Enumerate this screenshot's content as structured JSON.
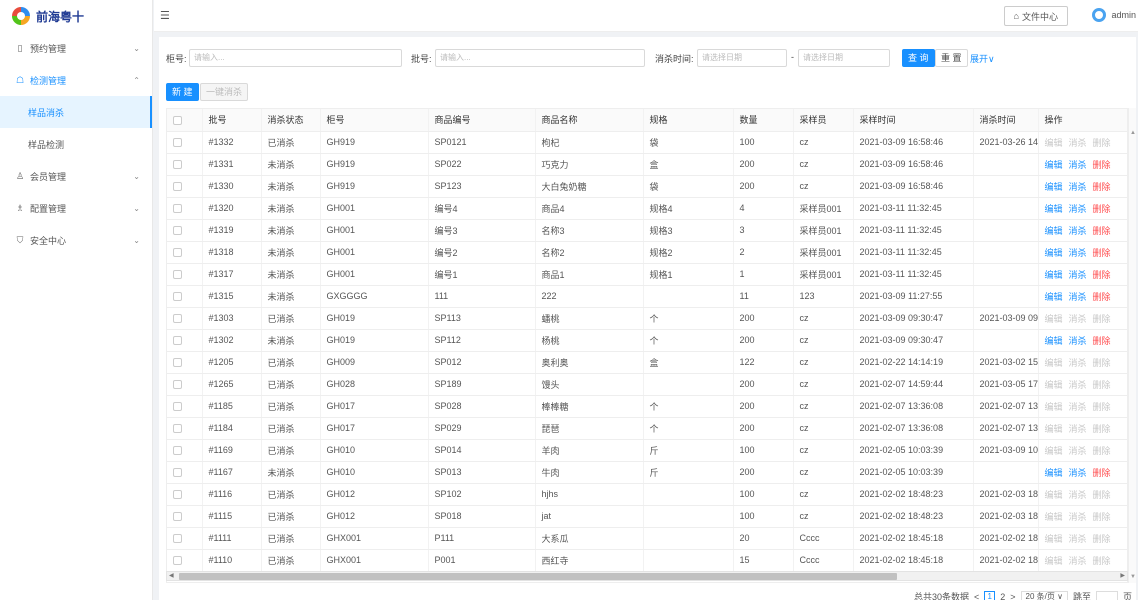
{
  "app": {
    "logo_text": "前海粤十"
  },
  "sidebar": {
    "items": [
      {
        "label": "预约管理",
        "icon": "calendar-icon",
        "glyph": "▯",
        "chev": "⌄"
      },
      {
        "label": "检测管理",
        "icon": "test-icon",
        "glyph": "☖",
        "chev": "⌃"
      },
      {
        "label": "会员管理",
        "icon": "user-icon",
        "glyph": "♙",
        "chev": "⌄"
      },
      {
        "label": "配置管理",
        "icon": "config-icon",
        "glyph": "♗",
        "chev": "⌄"
      },
      {
        "label": "安全中心",
        "icon": "shield-icon",
        "glyph": "⛉",
        "chev": "⌄"
      }
    ],
    "sub_items": [
      {
        "label": "样品消杀"
      },
      {
        "label": "样品检测"
      }
    ]
  },
  "header": {
    "fold_glyph": "☰",
    "file_center": "文件中心",
    "file_glyph": "⌂",
    "user_name": "admin"
  },
  "filter": {
    "cabinet_label": "柜号:",
    "cabinet_placeholder": "请输入...",
    "batch_label": "批号:",
    "batch_placeholder": "请输入...",
    "time_label": "消杀时间:",
    "date_start_placeholder": "请选择日期",
    "date_sep": "-",
    "date_end_placeholder": "请选择日期",
    "query": "查 询",
    "reset": "重 置",
    "expand": "展开∨"
  },
  "actions": {
    "new": "新 建",
    "batch_disinfect": "一键消杀"
  },
  "table": {
    "columns": [
      "批号",
      "消杀状态",
      "柜号",
      "商品编号",
      "商品名称",
      "规格",
      "数量",
      "采样员",
      "采样时间",
      "消杀时间",
      "操作"
    ],
    "op_labels": {
      "edit": "编辑",
      "disinfect": "消杀",
      "delete": "删除"
    },
    "rows": [
      {
        "batch": "#1332",
        "status": "已消杀",
        "cabinet": "GH919",
        "code": "SP0121",
        "name": "枸杞",
        "spec": "袋",
        "qty": "100",
        "sampler": "cz",
        "sample_time": "2021-03-09 16:58:46",
        "dis_time": "2021-03-26 14:",
        "enabled": false
      },
      {
        "batch": "#1331",
        "status": "未消杀",
        "cabinet": "GH919",
        "code": "SP022",
        "name": "巧克力",
        "spec": "盒",
        "qty": "200",
        "sampler": "cz",
        "sample_time": "2021-03-09 16:58:46",
        "dis_time": "",
        "enabled": true
      },
      {
        "batch": "#1330",
        "status": "未消杀",
        "cabinet": "GH919",
        "code": "SP123",
        "name": "大白兔奶糖",
        "spec": "袋",
        "qty": "200",
        "sampler": "cz",
        "sample_time": "2021-03-09 16:58:46",
        "dis_time": "",
        "enabled": true
      },
      {
        "batch": "#1320",
        "status": "未消杀",
        "cabinet": "GH001",
        "code": "编号4",
        "name": "商品4",
        "spec": "规格4",
        "qty": "4",
        "sampler": "采样员001",
        "sample_time": "2021-03-11 11:32:45",
        "dis_time": "",
        "enabled": true
      },
      {
        "batch": "#1319",
        "status": "未消杀",
        "cabinet": "GH001",
        "code": "编号3",
        "name": "名称3",
        "spec": "规格3",
        "qty": "3",
        "sampler": "采样员001",
        "sample_time": "2021-03-11 11:32:45",
        "dis_time": "",
        "enabled": true
      },
      {
        "batch": "#1318",
        "status": "未消杀",
        "cabinet": "GH001",
        "code": "编号2",
        "name": "名称2",
        "spec": "规格2",
        "qty": "2",
        "sampler": "采样员001",
        "sample_time": "2021-03-11 11:32:45",
        "dis_time": "",
        "enabled": true
      },
      {
        "batch": "#1317",
        "status": "未消杀",
        "cabinet": "GH001",
        "code": "编号1",
        "name": "商品1",
        "spec": "规格1",
        "qty": "1",
        "sampler": "采样员001",
        "sample_time": "2021-03-11 11:32:45",
        "dis_time": "",
        "enabled": true
      },
      {
        "batch": "#1315",
        "status": "未消杀",
        "cabinet": "GXGGGG",
        "code": "111",
        "name": "222",
        "spec": "",
        "qty": "11",
        "sampler": "123",
        "sample_time": "2021-03-09 11:27:55",
        "dis_time": "",
        "enabled": true
      },
      {
        "batch": "#1303",
        "status": "已消杀",
        "cabinet": "GH019",
        "code": "SP113",
        "name": "蟠桃",
        "spec": "个",
        "qty": "200",
        "sampler": "cz",
        "sample_time": "2021-03-09 09:30:47",
        "dis_time": "2021-03-09 09:",
        "enabled": false
      },
      {
        "batch": "#1302",
        "status": "未消杀",
        "cabinet": "GH019",
        "code": "SP112",
        "name": "杨桃",
        "spec": "个",
        "qty": "200",
        "sampler": "cz",
        "sample_time": "2021-03-09 09:30:47",
        "dis_time": "",
        "enabled": true
      },
      {
        "batch": "#1205",
        "status": "已消杀",
        "cabinet": "GH009",
        "code": "SP012",
        "name": "奥利奥",
        "spec": "盒",
        "qty": "122",
        "sampler": "cz",
        "sample_time": "2021-02-22 14:14:19",
        "dis_time": "2021-03-02 15:",
        "enabled": false
      },
      {
        "batch": "#1265",
        "status": "已消杀",
        "cabinet": "GH028",
        "code": "SP189",
        "name": "馒头",
        "spec": "",
        "qty": "200",
        "sampler": "cz",
        "sample_time": "2021-02-07 14:59:44",
        "dis_time": "2021-03-05 17:",
        "enabled": false
      },
      {
        "batch": "#1185",
        "status": "已消杀",
        "cabinet": "GH017",
        "code": "SP028",
        "name": "棒棒糖",
        "spec": "个",
        "qty": "200",
        "sampler": "cz",
        "sample_time": "2021-02-07 13:36:08",
        "dis_time": "2021-02-07 13:",
        "enabled": false
      },
      {
        "batch": "#1184",
        "status": "已消杀",
        "cabinet": "GH017",
        "code": "SP029",
        "name": "琵琶",
        "spec": "个",
        "qty": "200",
        "sampler": "cz",
        "sample_time": "2021-02-07 13:36:08",
        "dis_time": "2021-02-07 13:",
        "enabled": false
      },
      {
        "batch": "#1169",
        "status": "已消杀",
        "cabinet": "GH010",
        "code": "SP014",
        "name": "羊肉",
        "spec": "斤",
        "qty": "100",
        "sampler": "cz",
        "sample_time": "2021-02-05 10:03:39",
        "dis_time": "2021-03-09 10:",
        "enabled": false
      },
      {
        "batch": "#1167",
        "status": "未消杀",
        "cabinet": "GH010",
        "code": "SP013",
        "name": "牛肉",
        "spec": "斤",
        "qty": "200",
        "sampler": "cz",
        "sample_time": "2021-02-05 10:03:39",
        "dis_time": "",
        "enabled": true
      },
      {
        "batch": "#1116",
        "status": "已消杀",
        "cabinet": "GH012",
        "code": "SP102",
        "name": "hjhs",
        "spec": "",
        "qty": "100",
        "sampler": "cz",
        "sample_time": "2021-02-02 18:48:23",
        "dis_time": "2021-02-03 18:",
        "enabled": false
      },
      {
        "batch": "#1115",
        "status": "已消杀",
        "cabinet": "GH012",
        "code": "SP018",
        "name": "jat",
        "spec": "",
        "qty": "100",
        "sampler": "cz",
        "sample_time": "2021-02-02 18:48:23",
        "dis_time": "2021-02-03 18:",
        "enabled": false
      },
      {
        "batch": "#1111",
        "status": "已消杀",
        "cabinet": "GHX001",
        "code": "P111",
        "name": "大系瓜",
        "spec": "",
        "qty": "20",
        "sampler": "Cccc",
        "sample_time": "2021-02-02 18:45:18",
        "dis_time": "2021-02-02 18:",
        "enabled": false
      },
      {
        "batch": "#1110",
        "status": "已消杀",
        "cabinet": "GHX001",
        "code": "P001",
        "name": "西红寺",
        "spec": "",
        "qty": "15",
        "sampler": "Cccc",
        "sample_time": "2021-02-02 18:45:18",
        "dis_time": "2021-02-02 18:",
        "enabled": false
      }
    ]
  },
  "pagination": {
    "total": "总共30条数据",
    "prev": "<",
    "pages": [
      "1",
      "2"
    ],
    "next": ">",
    "page_size": "20 条/页 ∨",
    "jump_label": "跳至",
    "page_suffix": "页"
  }
}
